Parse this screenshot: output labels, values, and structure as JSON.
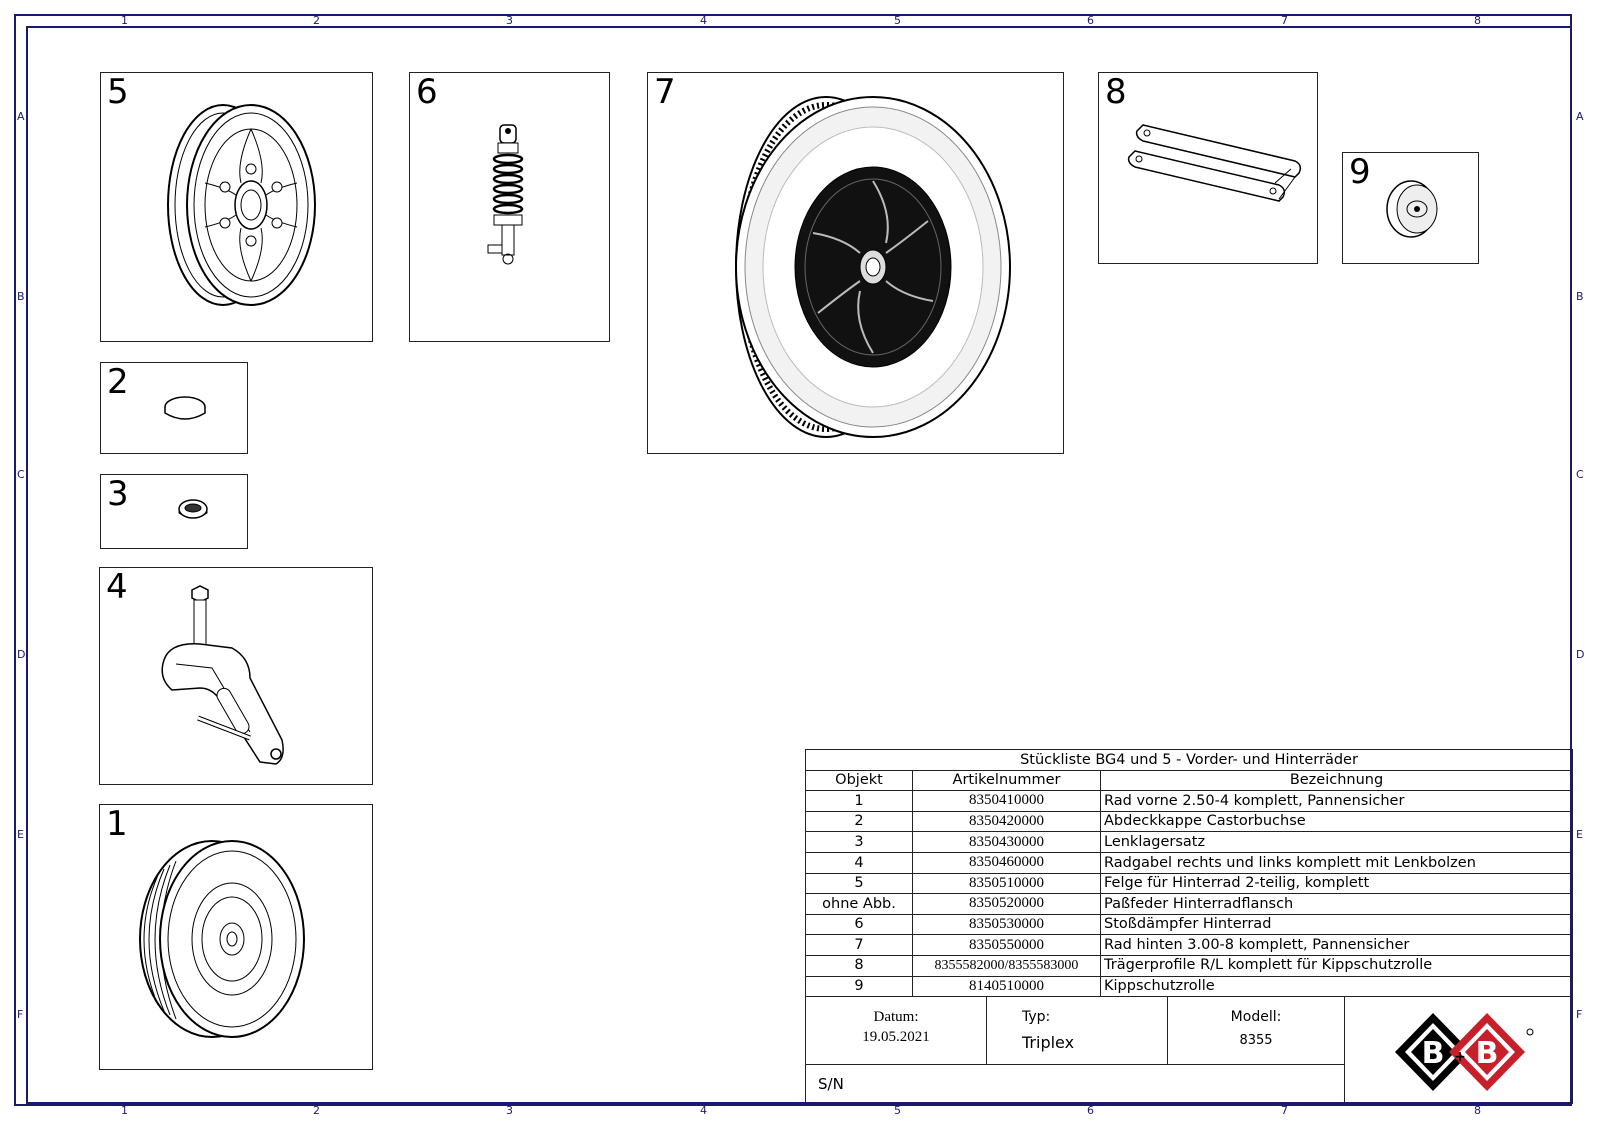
{
  "zones": {
    "columns": [
      "1",
      "2",
      "3",
      "4",
      "5",
      "6",
      "7",
      "8"
    ],
    "rows": [
      "A",
      "B",
      "C",
      "D",
      "E",
      "F"
    ]
  },
  "parts": [
    {
      "id": "5"
    },
    {
      "id": "6"
    },
    {
      "id": "7"
    },
    {
      "id": "8"
    },
    {
      "id": "9"
    },
    {
      "id": "2"
    },
    {
      "id": "3"
    },
    {
      "id": "4"
    },
    {
      "id": "1"
    }
  ],
  "bom": {
    "title": "Stückliste BG4 und 5 - Vorder- und Hinterräder",
    "headers": [
      "Objekt",
      "Artikelnummer",
      "Bezeichnung"
    ],
    "rows": [
      {
        "obj": "1",
        "art": "8350410000",
        "desc": "Rad vorne 2.50-4  komplett, Pannensicher"
      },
      {
        "obj": "2",
        "art": "8350420000",
        "desc": "Abdeckkappe Castorbuchse"
      },
      {
        "obj": "3",
        "art": "8350430000",
        "desc": "Lenklagersatz"
      },
      {
        "obj": "4",
        "art": "8350460000",
        "desc": "Radgabel rechts und links komplett mit Lenkbolzen"
      },
      {
        "obj": "5",
        "art": "8350510000",
        "desc": "Felge für Hinterrad 2-teilig, komplett"
      },
      {
        "obj": "ohne Abb.",
        "art": "8350520000",
        "desc": "Paßfeder Hinterradflansch"
      },
      {
        "obj": "6",
        "art": "8350530000",
        "desc": "Stoßdämpfer Hinterrad"
      },
      {
        "obj": "7",
        "art": "8350550000",
        "desc": "Rad hinten 3.00-8 komplett, Pannensicher"
      },
      {
        "obj": "8",
        "art": "8355582000/8355583000",
        "desc": "Trägerprofile R/L komplett für Kippschutzrolle"
      },
      {
        "obj": "9",
        "art": "8140510000",
        "desc": "Kippschutzrolle"
      }
    ]
  },
  "title_block": {
    "datum_label": "Datum:",
    "datum_value": "19.05.2021",
    "typ_label": "Typ:",
    "typ_value": "Triplex",
    "modell_label": "Modell:",
    "modell_value": "8355",
    "sn_label": "S/N"
  },
  "logo": {
    "text": "B+B",
    "left_letter": "B",
    "plus": "+",
    "right_letter": "B",
    "color_left": "#000000",
    "color_right": "#c8202a"
  }
}
